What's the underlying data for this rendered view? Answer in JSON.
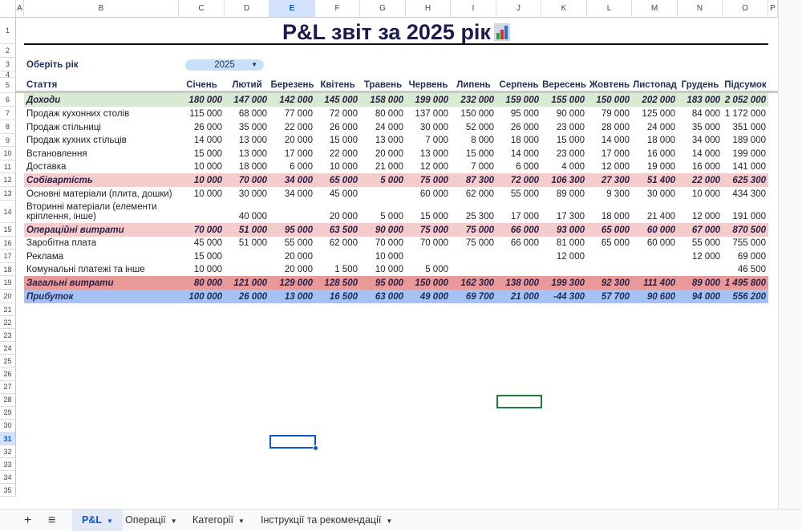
{
  "columns": [
    "A",
    "B",
    "C",
    "D",
    "E",
    "F",
    "G",
    "H",
    "I",
    "J",
    "K",
    "L",
    "M",
    "N",
    "O",
    "P"
  ],
  "selected_column": "E",
  "selected_row": 31,
  "title": "P&L звіт за 2025 рік",
  "year_label": "Оберіть рік",
  "year_select": "2025",
  "header": [
    "Стаття",
    "Січень",
    "Лютий",
    "Березень",
    "Квітень",
    "Травень",
    "Червень",
    "Липень",
    "Серпень",
    "Вересень",
    "Жовтень",
    "Листопад",
    "Грудень",
    "Підсумок"
  ],
  "rows": [
    {
      "type": "income",
      "label": "Доходи",
      "values": [
        "180 000",
        "147 000",
        "142 000",
        "145 000",
        "158 000",
        "199 000",
        "232 000",
        "159 000",
        "155 000",
        "150 000",
        "202 000",
        "183 000",
        "2 052 000"
      ]
    },
    {
      "type": "item",
      "label": "Продаж кухонних столів",
      "values": [
        "115 000",
        "68 000",
        "77 000",
        "72 000",
        "80 000",
        "137 000",
        "150 000",
        "95 000",
        "90 000",
        "79 000",
        "125 000",
        "84 000",
        "1 172 000"
      ]
    },
    {
      "type": "item",
      "label": "Продаж стільниці",
      "values": [
        "26 000",
        "35 000",
        "22 000",
        "26 000",
        "24 000",
        "30 000",
        "52 000",
        "26 000",
        "23 000",
        "28 000",
        "24 000",
        "35 000",
        "351 000"
      ]
    },
    {
      "type": "item",
      "label": "Продаж кухних стільців",
      "values": [
        "14 000",
        "13 000",
        "20 000",
        "15 000",
        "13 000",
        "7 000",
        "8 000",
        "18 000",
        "15 000",
        "14 000",
        "18 000",
        "34 000",
        "189 000"
      ]
    },
    {
      "type": "item",
      "label": "Встановлення",
      "values": [
        "15 000",
        "13 000",
        "17 000",
        "22 000",
        "20 000",
        "13 000",
        "15 000",
        "14 000",
        "23 000",
        "17 000",
        "16 000",
        "14 000",
        "199 000"
      ]
    },
    {
      "type": "item",
      "label": "Доставка",
      "values": [
        "10 000",
        "18 000",
        "6 000",
        "10 000",
        "21 000",
        "12 000",
        "7 000",
        "6 000",
        "4 000",
        "12 000",
        "19 000",
        "16 000",
        "141 000"
      ]
    },
    {
      "type": "cost",
      "label": "Собівартість",
      "values": [
        "10 000",
        "70 000",
        "34 000",
        "65 000",
        "5 000",
        "75 000",
        "87 300",
        "72 000",
        "106 300",
        "27 300",
        "51 400",
        "22 000",
        "625 300"
      ]
    },
    {
      "type": "item",
      "label": "Основні матеріали (плита, дошки)",
      "values": [
        "10 000",
        "30 000",
        "34 000",
        "45 000",
        "",
        "60 000",
        "62 000",
        "55 000",
        "89 000",
        "9 300",
        "30 000",
        "10 000",
        "434 300"
      ]
    },
    {
      "type": "item2",
      "label": "Вторинні матеріали (елементи",
      "label2": "кріплення, інше)",
      "values": [
        "",
        "40 000",
        "",
        "20 000",
        "5 000",
        "15 000",
        "25 300",
        "17 000",
        "17 300",
        "18 000",
        "21 400",
        "12 000",
        "191 000"
      ]
    },
    {
      "type": "cost",
      "label": "Операційні витрати",
      "values": [
        "70 000",
        "51 000",
        "95 000",
        "63 500",
        "90 000",
        "75 000",
        "75 000",
        "66 000",
        "93 000",
        "65 000",
        "60 000",
        "67 000",
        "870 500"
      ]
    },
    {
      "type": "item",
      "label": "Заробітна плата",
      "values": [
        "45 000",
        "51 000",
        "55 000",
        "62 000",
        "70 000",
        "70 000",
        "75 000",
        "66 000",
        "81 000",
        "65 000",
        "60 000",
        "55 000",
        "755 000"
      ]
    },
    {
      "type": "item",
      "label": "Реклама",
      "values": [
        "15 000",
        "",
        "20 000",
        "",
        "10 000",
        "",
        "",
        "",
        "12 000",
        "",
        "",
        "12 000",
        "69 000"
      ]
    },
    {
      "type": "item",
      "label": "Комунальні платежі та інше",
      "values": [
        "10 000",
        "",
        "20 000",
        "1 500",
        "10 000",
        "5 000",
        "",
        "",
        "",
        "",
        "",
        "",
        "46 500"
      ]
    },
    {
      "type": "total",
      "label": "Загальні витрати",
      "values": [
        "80 000",
        "121 000",
        "129 000",
        "128 500",
        "95 000",
        "150 000",
        "162 300",
        "138 000",
        "199 300",
        "92 300",
        "111 400",
        "89 000",
        "1 495 800"
      ]
    },
    {
      "type": "profit",
      "label": "Прибуток",
      "values": [
        "100 000",
        "26 000",
        "13 000",
        "16 500",
        "63 000",
        "49 000",
        "69 700",
        "21 000",
        "-44 300",
        "57 700",
        "90 600",
        "94 000",
        "556 200"
      ]
    }
  ],
  "colors": {
    "income": "#d9ead3",
    "cost": "#f4cccc",
    "total": "#ea9999",
    "profit": "#a4c2f4",
    "accent": "#0b57d0"
  },
  "tabs": {
    "add": "+",
    "menu": "≡",
    "sheets": [
      {
        "label": "P&L",
        "active": true
      },
      {
        "label": "Операції"
      },
      {
        "label": "Категорії"
      },
      {
        "label": "Інструкції та рекомендації"
      }
    ]
  }
}
